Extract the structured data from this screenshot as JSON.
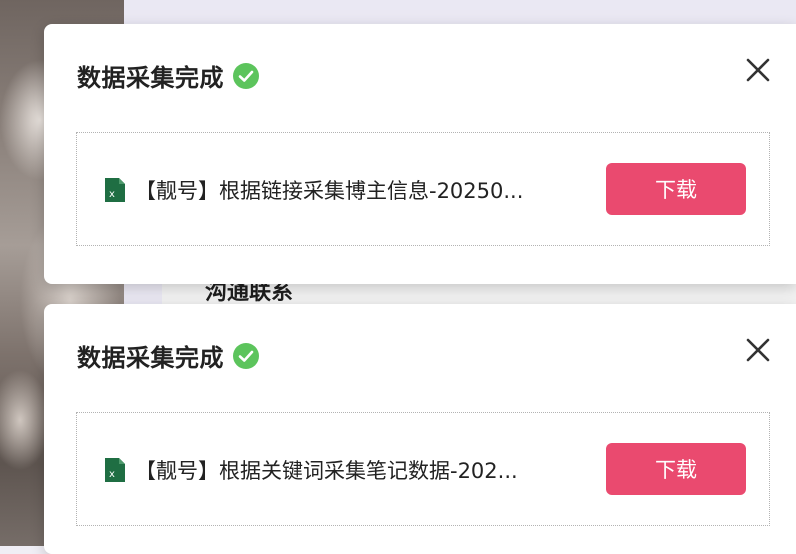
{
  "background": {
    "card_text": "沟通联系"
  },
  "notifications": [
    {
      "title": "数据采集完成",
      "status_icon": "check-circle-icon",
      "close_icon": "close-icon",
      "file_icon": "excel-file-icon",
      "file_name": "【靓号】根据链接采集博主信息-20250...",
      "download_label": "下载"
    },
    {
      "title": "数据采集完成",
      "status_icon": "check-circle-icon",
      "close_icon": "close-icon",
      "file_icon": "excel-file-icon",
      "file_name": "【靓号】根据关键词采集笔记数据-202...",
      "download_label": "下载"
    }
  ],
  "colors": {
    "accent": "#ea4a6f",
    "success": "#5cc45c",
    "excel_green": "#1f6e43"
  }
}
